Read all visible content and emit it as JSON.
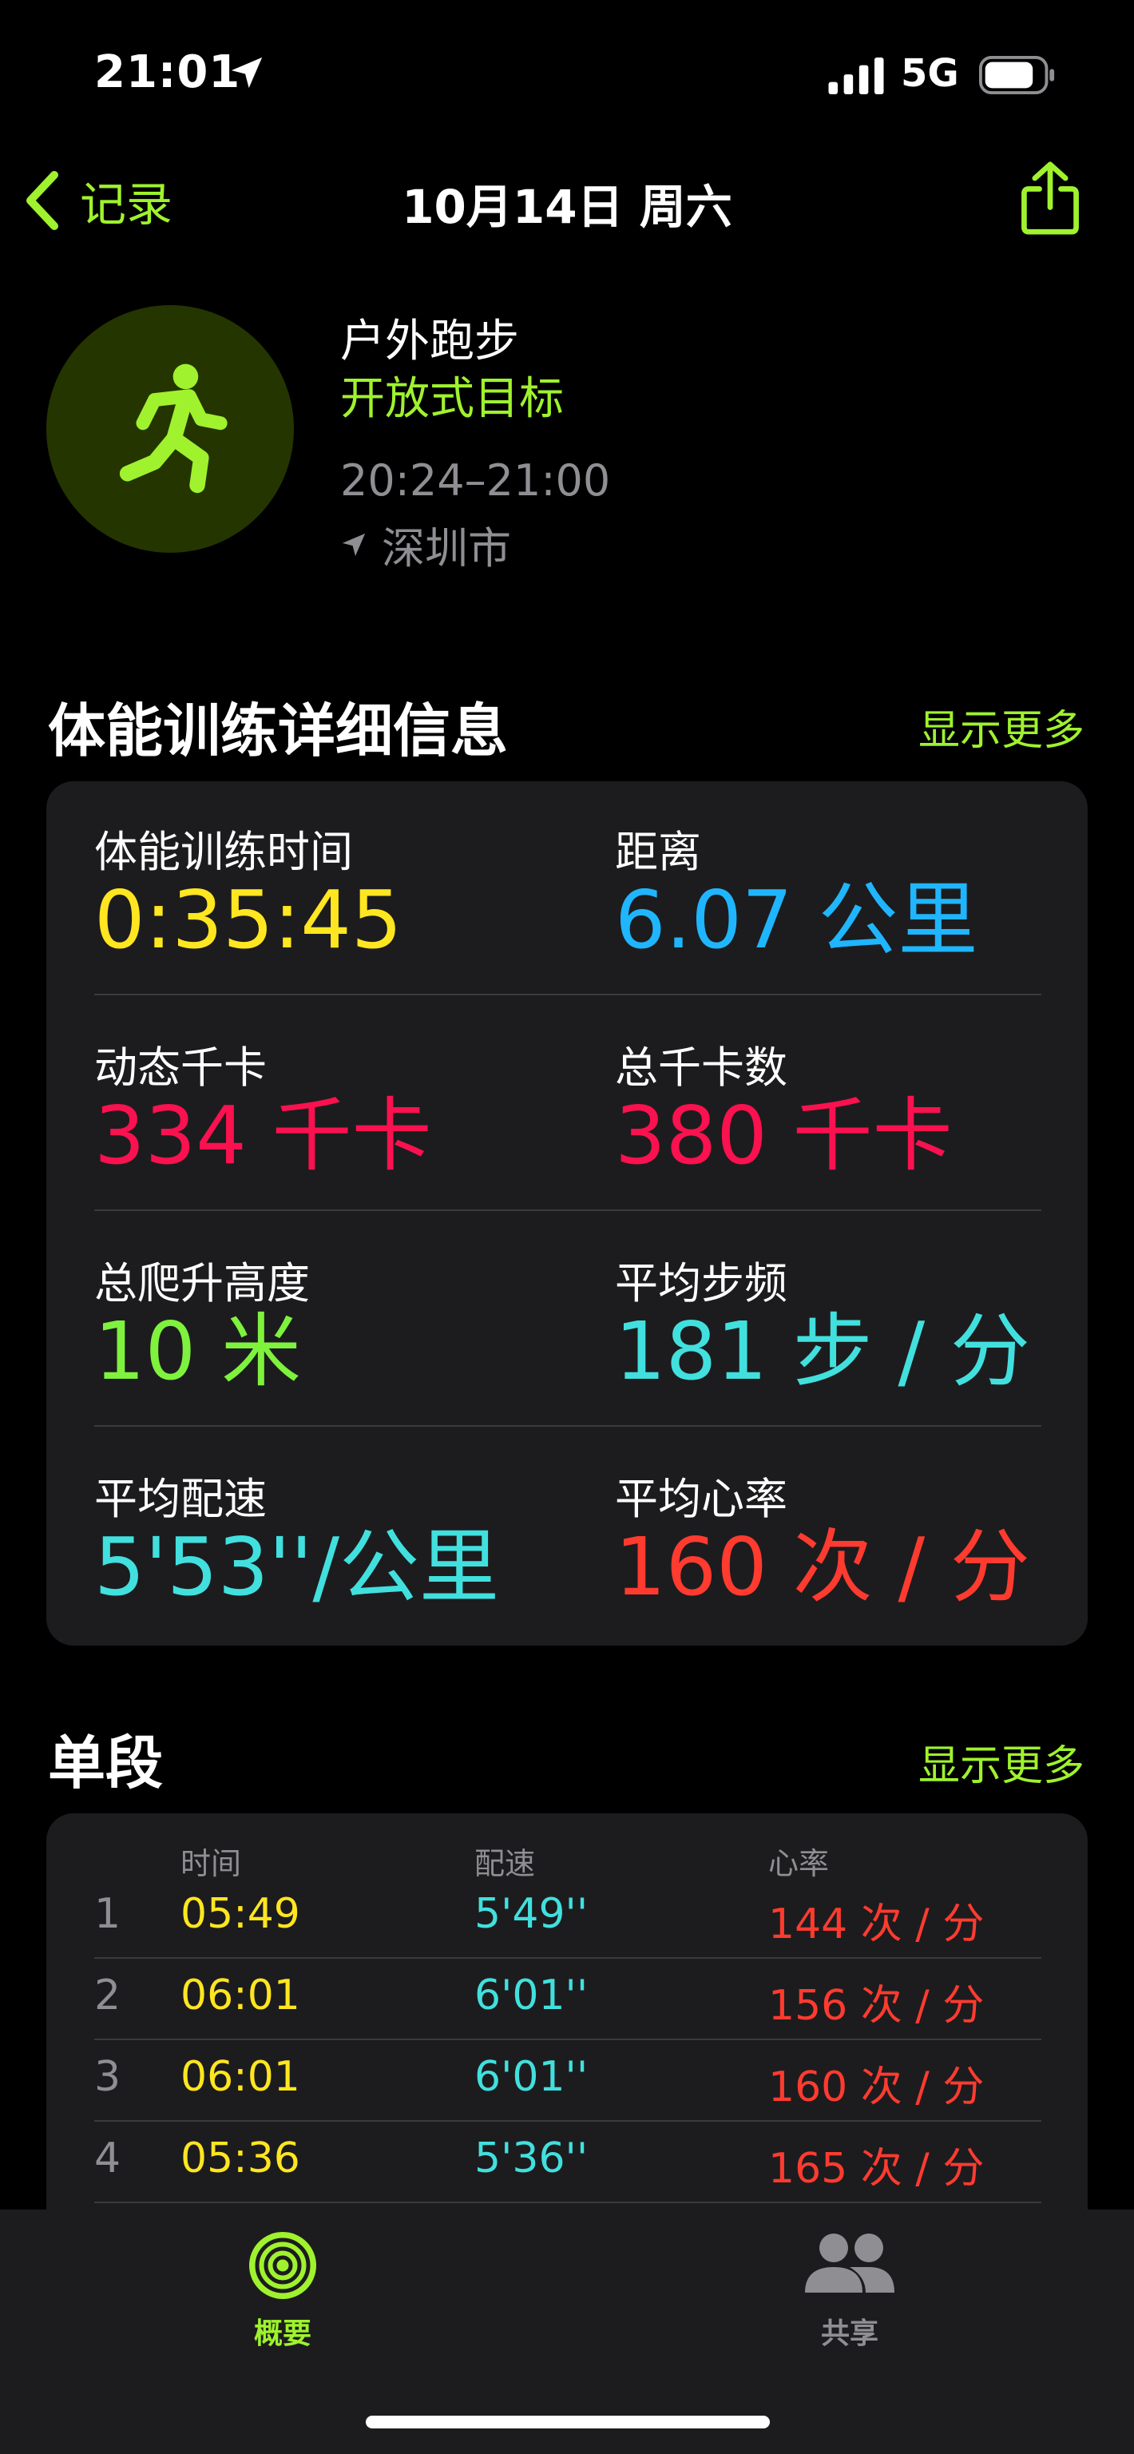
{
  "status_bar": {
    "time": "21:01",
    "network": "5G"
  },
  "nav": {
    "back_label": "记录",
    "title": "10月14日 周六"
  },
  "workout": {
    "type": "户外跑步",
    "goal": "开放式目标",
    "time_range": "20:24–21:00",
    "location": "深圳市"
  },
  "details": {
    "title": "体能训练详细信息",
    "more": "显示更多",
    "metrics": [
      {
        "label": "体能训练时间",
        "value": "0:35:45",
        "unit": "",
        "color": "#ffe620"
      },
      {
        "label": "距离",
        "value": "6.07",
        "unit": "公里",
        "color": "#1fb6ff"
      },
      {
        "label": "动态千卡",
        "value": "334",
        "unit": "千卡",
        "color": "#fa114f"
      },
      {
        "label": "总千卡数",
        "value": "380",
        "unit": "千卡",
        "color": "#fa114f"
      },
      {
        "label": "总爬升高度",
        "value": "10",
        "unit": "米",
        "color": "#7ef23d"
      },
      {
        "label": "平均步频",
        "value": "181",
        "unit": "步 / 分",
        "color": "#41e0de"
      },
      {
        "label": "平均配速",
        "value": "5'53''/",
        "unit": "公里",
        "color": "#41e0de"
      },
      {
        "label": "平均心率",
        "value": "160",
        "unit": "次 / 分",
        "color": "#ff3b30"
      }
    ]
  },
  "splits": {
    "title": "单段",
    "more": "显示更多",
    "headers": {
      "time": "时间",
      "pace": "配速",
      "heart": "心率"
    },
    "rows": [
      {
        "idx": "1",
        "time": "05:49",
        "pace": "5'49''",
        "heart": "144 次 / 分"
      },
      {
        "idx": "2",
        "time": "06:01",
        "pace": "6'01''",
        "heart": "156 次 / 分"
      },
      {
        "idx": "3",
        "time": "06:01",
        "pace": "6'01''",
        "heart": "160 次 / 分"
      },
      {
        "idx": "4",
        "time": "05:36",
        "pace": "5'36''",
        "heart": "165 次 / 分"
      }
    ],
    "colors": {
      "time": "#ffe620",
      "pace": "#41e0de",
      "heart": "#ff3b30"
    }
  },
  "tabs": [
    {
      "label": "概要",
      "icon": "activity-rings-icon",
      "active": true
    },
    {
      "label": "共享",
      "icon": "people-icon",
      "active": false
    }
  ],
  "colors": {
    "accent": "#9ff22d",
    "card": "#1c1c1e",
    "muted": "#8e8e93"
  }
}
